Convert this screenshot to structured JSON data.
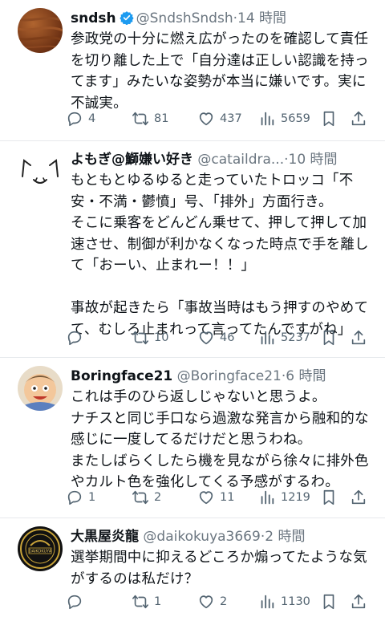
{
  "tweets": [
    {
      "name": "sndsh",
      "handle": "@SndshSndsh",
      "time": "·14 時間",
      "verified": true,
      "lines": [
        "参政党の十分に燃え広がったのを確認して責任",
        "を切り離した上で「自分達は正しい認識を持っ",
        "てます」みたいな姿勢が本当に嫌いです。実に",
        "不誠実。"
      ],
      "replies": "4",
      "retweets": "81",
      "likes": "437",
      "views": "5659"
    },
    {
      "name": "よもぎ@鰤嫌い好き",
      "handle": "@cataildra...",
      "time": "·10 時間",
      "verified": false,
      "lines": [
        "もともとゆるゆると走っていたトロッコ「不",
        "安・不満・鬱憤」号、「排外」方面行き。",
        "そこに乗客をどんどん乗せて、押して押して加",
        "速させ、制御が利かなくなった時点で手を離し",
        "て「おーい、止まれー！！」",
        "",
        "事故が起きたら「事故当時はもう押すのやめて",
        "て、むしろ止まれって言ってたんですがね」"
      ],
      "replies": "",
      "retweets": "10",
      "likes": "46",
      "views": "5237"
    },
    {
      "name": "Boringface21",
      "handle": "@Boringface21",
      "time": "·6 時間",
      "verified": false,
      "lines": [
        "これは手のひら返しじゃないと思うよ。",
        "ナチスと同じ手口なら過激な発言から融和的な",
        "感じに一度してるだけだと思うわね。",
        "またしばらくしたら機を見ながら徐々に排外色",
        "やカルト色を強化してくる予感がするわ。"
      ],
      "replies": "1",
      "retweets": "2",
      "likes": "11",
      "views": "1219"
    },
    {
      "name": "大黒屋炎龍",
      "handle": "@daikokuya3669",
      "time": "·2 時間",
      "verified": false,
      "avatar_text": "DAIKOKUYA",
      "lines": [
        "選挙期間中に抑えるどころか煽ってたような気",
        "がするのは私だけ？"
      ],
      "replies": "",
      "retweets": "1",
      "likes": "2",
      "views": "1130"
    }
  ],
  "colors": {
    "text": "#0f1419",
    "muted": "#536471",
    "verified": "#1d9bf0",
    "divider": "#e6e9ec"
  },
  "icons": [
    "reply-icon",
    "retweet-icon",
    "like-icon",
    "views-icon",
    "bookmark-icon",
    "share-icon",
    "verified-icon"
  ]
}
